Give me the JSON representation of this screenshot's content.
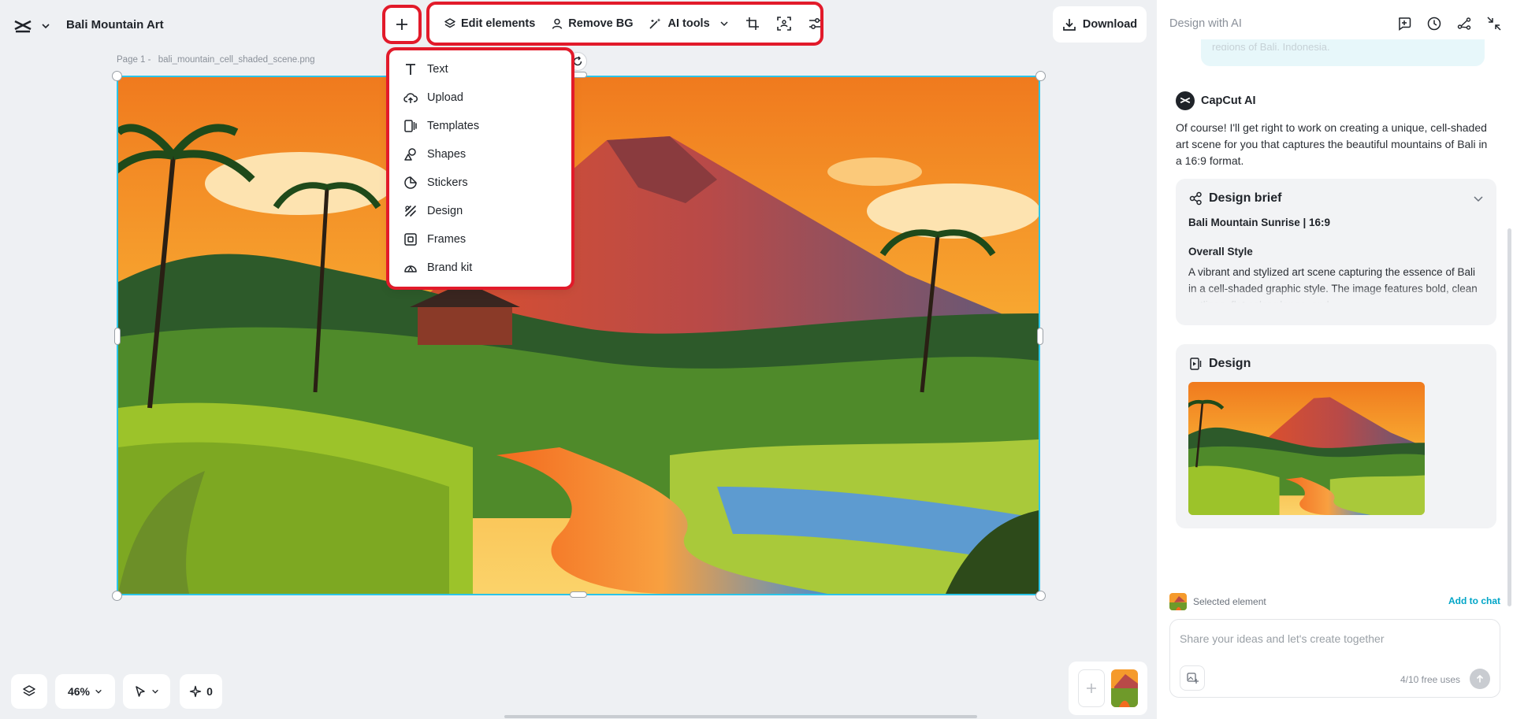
{
  "app": {
    "project_title": "Bali Mountain Art"
  },
  "toolbar": {
    "edit_elements": "Edit elements",
    "remove_bg": "Remove BG",
    "ai_tools": "AI tools"
  },
  "download_label": "Download",
  "canvas": {
    "page_label": "Page 1 -",
    "file_name": "bali_mountain_cell_shaded_scene.png"
  },
  "add_menu": {
    "items": [
      {
        "label": "Text",
        "icon": "text-icon"
      },
      {
        "label": "Upload",
        "icon": "upload-cloud-icon"
      },
      {
        "label": "Templates",
        "icon": "templates-icon"
      },
      {
        "label": "Shapes",
        "icon": "shapes-icon"
      },
      {
        "label": "Stickers",
        "icon": "sticker-icon"
      },
      {
        "label": "Design",
        "icon": "design-icon"
      },
      {
        "label": "Frames",
        "icon": "frame-icon"
      },
      {
        "label": "Brand kit",
        "icon": "brand-kit-icon"
      }
    ]
  },
  "panel": {
    "header": "Design with AI",
    "user_bubble_text": "regions of Bali, Indonesia.",
    "ai_name": "CapCut AI",
    "ai_message": "Of course! I'll get right to work on creating a unique, cell-shaded art scene for you that captures the beautiful mountains of Bali in a 16:9 format.",
    "brief": {
      "title": "Design brief",
      "subtitle": "Bali Mountain Sunrise | 16:9",
      "section": "Overall Style",
      "text": "A vibrant and stylized art scene capturing the essence of Bali in a cell-shaded graphic style. The image features bold, clean outlines, flat color planes, and"
    },
    "design": {
      "title": "Design"
    },
    "selected_element": "Selected element",
    "add_to_chat": "Add to chat",
    "chat_placeholder": "Share your ideas and let's create together",
    "free_uses": "4/10 free uses"
  },
  "bottom": {
    "zoom": "46%",
    "ai_count": "0"
  },
  "colors": {
    "accent": "#00a5c7",
    "highlight": "#e21a2a",
    "selection": "#2bc4e8"
  }
}
